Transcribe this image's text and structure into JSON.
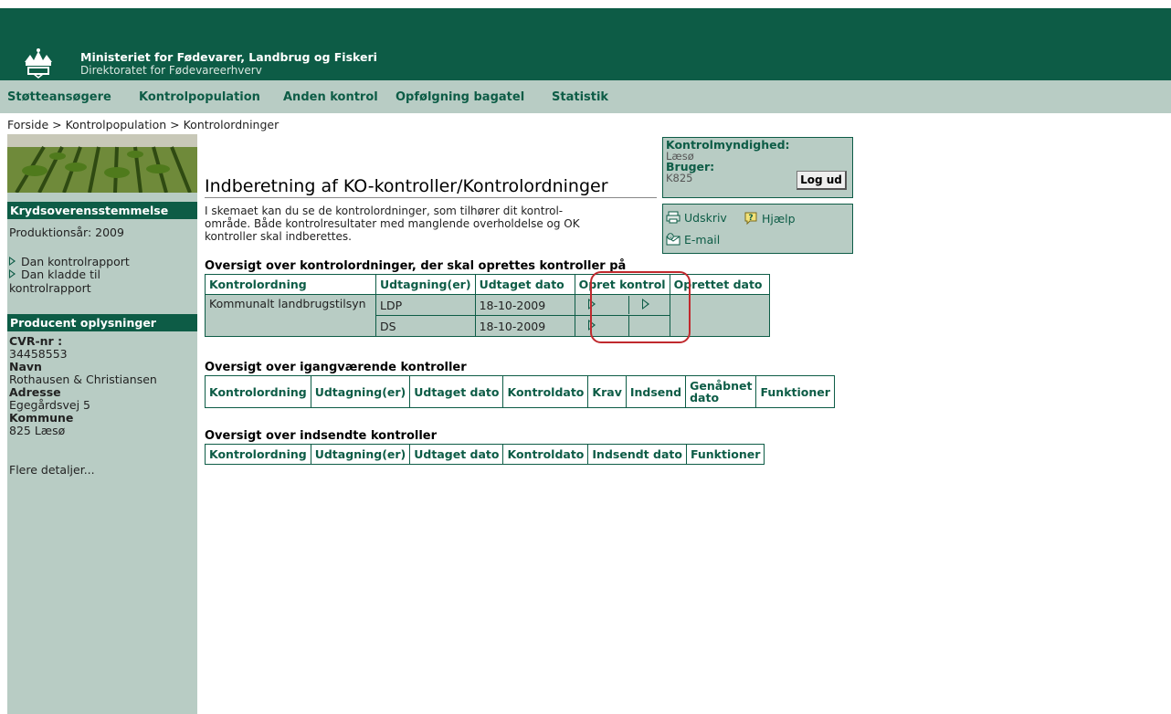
{
  "header": {
    "ministry": "Ministeriet for Fødevarer, Landbrug og Fiskeri",
    "directorate": "Direktoratet for Fødevareerhverv"
  },
  "nav": [
    "Støtteansøgere",
    "Kontrolpopulation",
    "Anden kontrol",
    "Opfølgning bagatel",
    "Statistik"
  ],
  "breadcrumb": {
    "home": "Forside",
    "sep1": ">",
    "level1": "Kontrolpopulation",
    "sep2": ">",
    "current": "Kontrolordninger"
  },
  "sidebar": {
    "section1": "Krydsoverensstemmelse",
    "production_year": "Produktionsår: 2009",
    "link1": "Dan kontrolrapport",
    "link2_line1": "Dan kladde til",
    "link2_line2": "kontrolrapport",
    "section2": "Producent oplysninger",
    "cvr_label": "CVR-nr :",
    "cvr_value": "34458553",
    "name_label": "Navn",
    "name_value": "Rothausen & Christiansen",
    "address_label": "Adresse",
    "address_value": "Egegårdsvej 5",
    "municipality_label": "Kommune",
    "municipality_value": "825 Læsø",
    "more": "Flere detaljer..."
  },
  "main": {
    "title": "Indberetning af KO-kontroller/Kontrolordninger",
    "intro_line1": "I skemaet kan du se de kontrolordninger, som tilhører dit kontrol-",
    "intro_line2": "område. Både kontrolresultater med manglende overholdelse og OK",
    "intro_line3": "kontroller skal indberettes."
  },
  "authority": {
    "label": "Kontrolmyndighed:",
    "value": "Læsø",
    "user_label": "Bruger:",
    "user_value": "K825",
    "logout": "Log ud"
  },
  "tools": {
    "print": "Udskriv",
    "help": "Hjælp",
    "email": "E-mail"
  },
  "table1": {
    "title": "Oversigt over kontrolordninger, der skal oprettes kontroller på",
    "headers": [
      "Kontrolordning",
      "Udtagning(er)",
      "Udtaget dato",
      "Opret kontrol",
      "Oprettet dato"
    ],
    "rows": [
      {
        "ordning": "Kommunalt landbrugstilsyn",
        "udtagning": "LDP",
        "dato": "18-10-2009"
      },
      {
        "ordning": "",
        "udtagning": "DS",
        "dato": "18-10-2009"
      }
    ]
  },
  "table2": {
    "title": "Oversigt over igangværende kontroller",
    "headers": [
      "Kontrolordning",
      "Udtagning(er)",
      "Udtaget dato",
      "Kontroldato",
      "Krav",
      "Indsend",
      "Genåbnet dato",
      "Funktioner"
    ],
    "reopened_line1": "Genåbnet",
    "reopened_line2": "dato"
  },
  "table3": {
    "title": "Oversigt over indsendte kontroller",
    "headers": [
      "Kontrolordning",
      "Udtagning(er)",
      "Udtaget dato",
      "Kontroldato",
      "Indsendt dato",
      "Funktioner"
    ]
  },
  "colors": {
    "brand_green": "#0d5c46",
    "panel": "#b8ccc4",
    "highlight": "#c0292d"
  }
}
